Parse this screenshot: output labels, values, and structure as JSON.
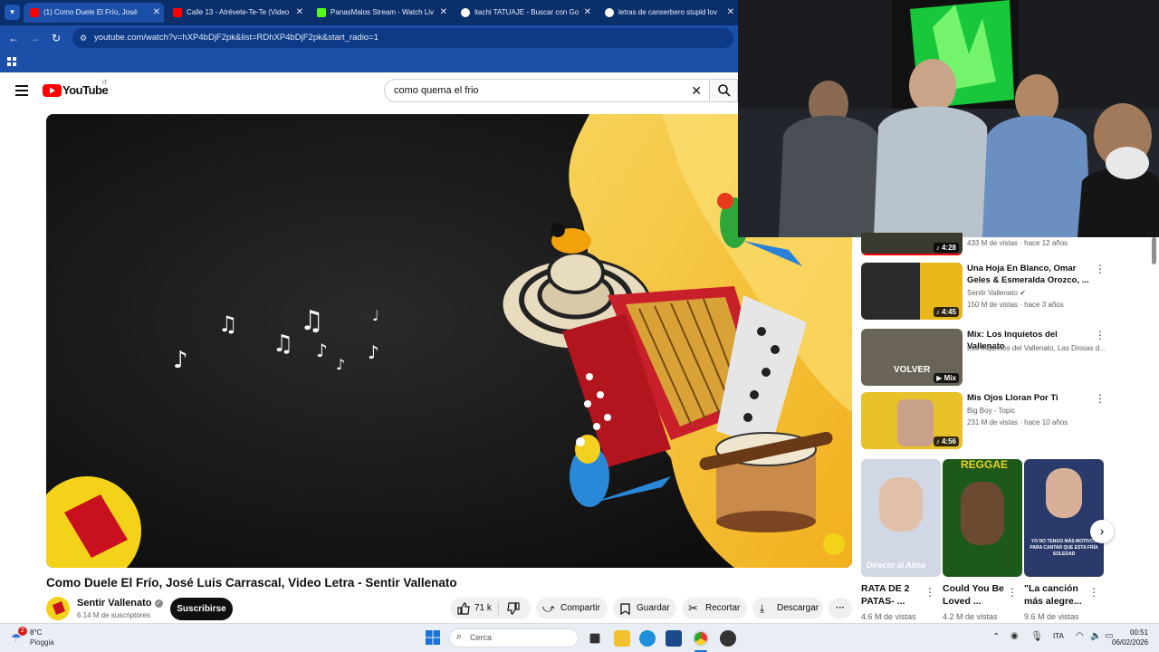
{
  "browser": {
    "tabs": [
      {
        "label": "(1) Como Duele El Frío, José",
        "active": true
      },
      {
        "label": "Calle 13 - Atrévete-Te-Te (Video",
        "active": false
      },
      {
        "label": "PanasMalos Stream - Watch Liv",
        "active": false
      },
      {
        "label": "itachi TATUAJE - Buscar con Go",
        "active": false
      },
      {
        "label": "letras de canserbero stupid lov",
        "active": false
      }
    ],
    "url": "youtube.com/watch?v=hXP4bDjF2pk&list=RDhXP4bDjF2pk&start_radio=1"
  },
  "youtube": {
    "logo_text": "YouTube",
    "region": "IT",
    "search_value": "como quema el frio"
  },
  "video": {
    "title": "Como Duele El Frío, José Luis Carrascal, Video Letra - Sentir Vallenato",
    "channel": "Sentir Vallenato",
    "subscribers": "6.14 M de suscriptores",
    "subscribe_label": "Suscribirse",
    "likes": "71 k",
    "share_label": "Compartir",
    "save_label": "Guardar",
    "clip_label": "Recortar",
    "download_label": "Descargar"
  },
  "sidebar": [
    {
      "title": "",
      "meta1": "433 M de vistas · hace 12 años",
      "meta2": "",
      "duration": "4:28"
    },
    {
      "title": "Una Hoja En Blanco, Omar Geles & Esmeralda Orozco, ...",
      "meta1": "Sentir Vallenato",
      "meta2": "150 M de vistas · hace 3 años",
      "duration": "4:45"
    },
    {
      "title": "Mix: Los Inquietos del Vallenato",
      "meta1": "Los Inquietos del Vallenato, Las Diosas d...",
      "meta2": "",
      "duration": "Mix",
      "thumb_text": "VOLVER"
    },
    {
      "title": "Mis Ojos Lloran Por Ti",
      "meta1": "Big Boy - Topic",
      "meta2": "231 M de vistas · hace 10 años",
      "duration": "4:56"
    }
  ],
  "shorts": [
    {
      "title": "RATA DE 2 PATAS- ...",
      "views": "4.6 M de vistas",
      "thumb_text": "Directo al Alma"
    },
    {
      "title": "Could You Be Loved ...",
      "views": "4.2 M de vistas",
      "thumb_text": "REGGAE"
    },
    {
      "title": "\"La canción más alegre...",
      "views": "9.6 M de vistas",
      "thumb_text": "YO NO TENGO MÁS MOTIVOS PARA CANTAR QUE ESTA FRÍA SOLEDAD"
    }
  ],
  "taskbar": {
    "weather_temp": "8°C",
    "weather_desc": "Pioggia",
    "notif_count": "2",
    "search_placeholder": "Cerca",
    "lang": "ITA",
    "time": "00:51",
    "date": "06/02/2026"
  }
}
